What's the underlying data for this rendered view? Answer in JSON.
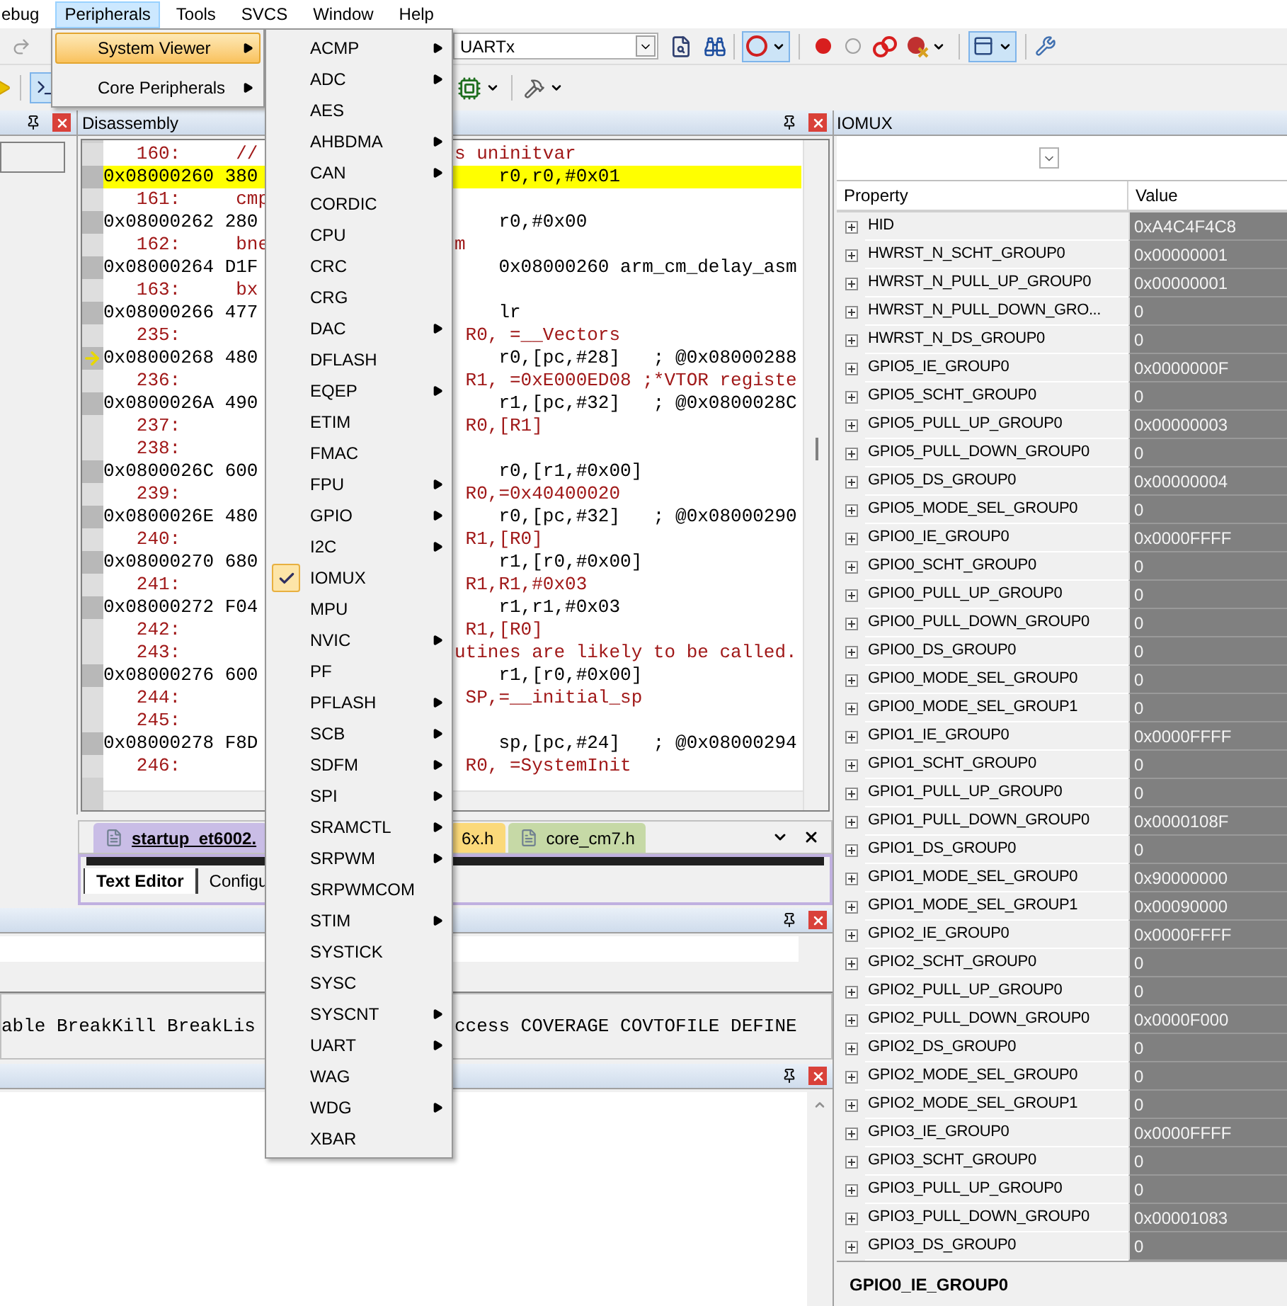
{
  "menubar": [
    {
      "label": "ebug",
      "selected": false
    },
    {
      "label": "Peripherals",
      "selected": true
    },
    {
      "label": "Tools",
      "selected": false
    },
    {
      "label": "SVCS",
      "selected": false
    },
    {
      "label": "Window",
      "selected": false
    },
    {
      "label": "Help",
      "selected": false
    }
  ],
  "peripherals_menu": [
    {
      "label": "System Viewer",
      "selected": true,
      "submenu": true
    },
    {
      "label": "Core Peripherals",
      "selected": false,
      "submenu": true
    }
  ],
  "system_viewer_menu": [
    {
      "label": "ACMP",
      "submenu": true,
      "checked": false
    },
    {
      "label": "ADC",
      "submenu": true,
      "checked": false
    },
    {
      "label": "AES",
      "submenu": false,
      "checked": false
    },
    {
      "label": "AHBDMA",
      "submenu": true,
      "checked": false
    },
    {
      "label": "CAN",
      "submenu": true,
      "checked": false
    },
    {
      "label": "CORDIC",
      "submenu": false,
      "checked": false
    },
    {
      "label": "CPU",
      "submenu": false,
      "checked": false
    },
    {
      "label": "CRC",
      "submenu": false,
      "checked": false
    },
    {
      "label": "CRG",
      "submenu": false,
      "checked": false
    },
    {
      "label": "DAC",
      "submenu": true,
      "checked": false
    },
    {
      "label": "DFLASH",
      "submenu": false,
      "checked": false
    },
    {
      "label": "EQEP",
      "submenu": true,
      "checked": false
    },
    {
      "label": "ETIM",
      "submenu": false,
      "checked": false
    },
    {
      "label": "FMAC",
      "submenu": false,
      "checked": false
    },
    {
      "label": "FPU",
      "submenu": true,
      "checked": false
    },
    {
      "label": "GPIO",
      "submenu": true,
      "checked": false
    },
    {
      "label": "I2C",
      "submenu": true,
      "checked": false
    },
    {
      "label": "IOMUX",
      "submenu": false,
      "checked": true
    },
    {
      "label": "MPU",
      "submenu": false,
      "checked": false
    },
    {
      "label": "NVIC",
      "submenu": true,
      "checked": false
    },
    {
      "label": "PF",
      "submenu": false,
      "checked": false
    },
    {
      "label": "PFLASH",
      "submenu": true,
      "checked": false
    },
    {
      "label": "SCB",
      "submenu": true,
      "checked": false
    },
    {
      "label": "SDFM",
      "submenu": true,
      "checked": false
    },
    {
      "label": "SPI",
      "submenu": true,
      "checked": false
    },
    {
      "label": "SRAMCTL",
      "submenu": true,
      "checked": false
    },
    {
      "label": "SRPWM",
      "submenu": true,
      "checked": false
    },
    {
      "label": "SRPWMCOM",
      "submenu": false,
      "checked": false
    },
    {
      "label": "STIM",
      "submenu": true,
      "checked": false
    },
    {
      "label": "SYSTICK",
      "submenu": false,
      "checked": false
    },
    {
      "label": "SYSC",
      "submenu": false,
      "checked": false
    },
    {
      "label": "SYSCNT",
      "submenu": true,
      "checked": false
    },
    {
      "label": "UART",
      "submenu": true,
      "checked": false
    },
    {
      "label": "WAG",
      "submenu": false,
      "checked": false
    },
    {
      "label": "WDG",
      "submenu": true,
      "checked": false
    },
    {
      "label": "XBAR",
      "submenu": false,
      "checked": false
    }
  ],
  "toolbar": {
    "target_combo": "UARTx"
  },
  "disassembly": {
    "title": "Disassembly",
    "rows": [
      {
        "kind": "src",
        "left": "   160:     //",
        "right": "s uninitvar",
        "highlighted": false,
        "current": false
      },
      {
        "kind": "asm",
        "left": "0x08000260 380",
        "right": "    r0,r0,#0x01",
        "highlighted": true,
        "current": false
      },
      {
        "kind": "src",
        "left": "   161:     cmp",
        "right": "",
        "highlighted": false,
        "current": false
      },
      {
        "kind": "asm",
        "left": "0x08000262 280",
        "right": "    r0,#0x00",
        "highlighted": false,
        "current": false
      },
      {
        "kind": "src",
        "left": "   162:     bne",
        "right": "m",
        "highlighted": false,
        "current": false
      },
      {
        "kind": "asm",
        "left": "0x08000264 D1F",
        "right": "    0x08000260 arm_cm_delay_asm",
        "highlighted": false,
        "current": false
      },
      {
        "kind": "src",
        "left": "   163:     bx",
        "right": "",
        "highlighted": false,
        "current": false
      },
      {
        "kind": "asm",
        "left": "0x08000266 477",
        "right": "    lr",
        "highlighted": false,
        "current": false
      },
      {
        "kind": "src",
        "left": "   235:",
        "right": " R0, =__Vectors",
        "highlighted": false,
        "current": false
      },
      {
        "kind": "asm",
        "left": "0x08000268 480",
        "right": "    r0,[pc,#28]   ; @0x08000288",
        "highlighted": false,
        "current": true
      },
      {
        "kind": "src",
        "left": "   236:",
        "right": " R1, =0xE000ED08 ;*VTOR registe",
        "highlighted": false,
        "current": false
      },
      {
        "kind": "asm",
        "left": "0x0800026A 490",
        "right": "    r1,[pc,#32]   ; @0x0800028C",
        "highlighted": false,
        "current": false
      },
      {
        "kind": "src",
        "left": "   237:",
        "right": " R0,[R1]",
        "highlighted": false,
        "current": false
      },
      {
        "kind": "src",
        "left": "   238:",
        "right": "",
        "highlighted": false,
        "current": false
      },
      {
        "kind": "asm",
        "left": "0x0800026C 600",
        "right": "    r0,[r1,#0x00]",
        "highlighted": false,
        "current": false
      },
      {
        "kind": "src",
        "left": "   239:",
        "right": " R0,=0x40400020",
        "highlighted": false,
        "current": false
      },
      {
        "kind": "asm",
        "left": "0x0800026E 480",
        "right": "    r0,[pc,#32]   ; @0x08000290",
        "highlighted": false,
        "current": false
      },
      {
        "kind": "src",
        "left": "   240:",
        "right": " R1,[R0]",
        "highlighted": false,
        "current": false
      },
      {
        "kind": "asm",
        "left": "0x08000270 680",
        "right": "    r1,[r0,#0x00]",
        "highlighted": false,
        "current": false
      },
      {
        "kind": "src",
        "left": "   241:",
        "right": " R1,R1,#0x03",
        "highlighted": false,
        "current": false
      },
      {
        "kind": "asm",
        "left": "0x08000272 F04",
        "right": "    r1,r1,#0x03",
        "highlighted": false,
        "current": false
      },
      {
        "kind": "src",
        "left": "   242:",
        "right": " R1,[R0]",
        "highlighted": false,
        "current": false
      },
      {
        "kind": "src",
        "left": "   243:",
        "right": "utines are likely to be called.",
        "highlighted": false,
        "current": false
      },
      {
        "kind": "asm",
        "left": "0x08000276 600",
        "right": "    r1,[r0,#0x00]",
        "highlighted": false,
        "current": false
      },
      {
        "kind": "src",
        "left": "   244:",
        "right": " SP,=__initial_sp",
        "highlighted": false,
        "current": false
      },
      {
        "kind": "src",
        "left": "   245:",
        "right": "",
        "highlighted": false,
        "current": false
      },
      {
        "kind": "asm",
        "left": "0x08000278 F8D",
        "right": "    sp,[pc,#24]   ; @0x08000294",
        "highlighted": false,
        "current": false
      },
      {
        "kind": "src",
        "left": "   246:",
        "right": " R0, =SystemInit",
        "highlighted": false,
        "current": false
      }
    ]
  },
  "file_tabs": [
    {
      "label": "startup_et6002.",
      "color": "#c9bde6",
      "selected": true
    },
    {
      "label": "6x.h",
      "color": "#fbd97a",
      "selected": false
    },
    {
      "label": "core_cm7.h",
      "color": "#c6d9a6",
      "selected": false
    }
  ],
  "editor_tabs": [
    {
      "label": "Text Editor",
      "selected": true
    },
    {
      "label": "Configu",
      "selected": false
    }
  ],
  "command": {
    "help_left": "able BreakKill BreakLis",
    "help_right": "ccess COVERAGE COVTOFILE DEFINE"
  },
  "iomux": {
    "title": "IOMUX",
    "columns": [
      "Property",
      "Value"
    ],
    "footer": "GPIO0_IE_GROUP0",
    "rows": [
      {
        "name": "HID",
        "value": "0xA4C4F4C8",
        "expanded": false
      },
      {
        "name": "HWRST_N_SCHT_GROUP0",
        "value": "0x00000001",
        "expanded": false
      },
      {
        "name": "HWRST_N_PULL_UP_GROUP0",
        "value": "0x00000001",
        "expanded": false
      },
      {
        "name": "HWRST_N_PULL_DOWN_GRO...",
        "value": "0",
        "expanded": false
      },
      {
        "name": "HWRST_N_DS_GROUP0",
        "value": "0",
        "expanded": false
      },
      {
        "name": "GPIO5_IE_GROUP0",
        "value": "0x0000000F",
        "expanded": false
      },
      {
        "name": "GPIO5_SCHT_GROUP0",
        "value": "0",
        "expanded": false
      },
      {
        "name": "GPIO5_PULL_UP_GROUP0",
        "value": "0x00000003",
        "expanded": false
      },
      {
        "name": "GPIO5_PULL_DOWN_GROUP0",
        "value": "0",
        "expanded": false
      },
      {
        "name": "GPIO5_DS_GROUP0",
        "value": "0x00000004",
        "expanded": false
      },
      {
        "name": "GPIO5_MODE_SEL_GROUP0",
        "value": "0",
        "expanded": false
      },
      {
        "name": "GPIO0_IE_GROUP0",
        "value": "0x0000FFFF",
        "expanded": false
      },
      {
        "name": "GPIO0_SCHT_GROUP0",
        "value": "0",
        "expanded": false
      },
      {
        "name": "GPIO0_PULL_UP_GROUP0",
        "value": "0",
        "expanded": false
      },
      {
        "name": "GPIO0_PULL_DOWN_GROUP0",
        "value": "0",
        "expanded": false
      },
      {
        "name": "GPIO0_DS_GROUP0",
        "value": "0",
        "expanded": false
      },
      {
        "name": "GPIO0_MODE_SEL_GROUP0",
        "value": "0",
        "expanded": false
      },
      {
        "name": "GPIO0_MODE_SEL_GROUP1",
        "value": "0",
        "expanded": false
      },
      {
        "name": "GPIO1_IE_GROUP0",
        "value": "0x0000FFFF",
        "expanded": false
      },
      {
        "name": "GPIO1_SCHT_GROUP0",
        "value": "0",
        "expanded": false
      },
      {
        "name": "GPIO1_PULL_UP_GROUP0",
        "value": "0",
        "expanded": false
      },
      {
        "name": "GPIO1_PULL_DOWN_GROUP0",
        "value": "0x0000108F",
        "expanded": false
      },
      {
        "name": "GPIO1_DS_GROUP0",
        "value": "0",
        "expanded": false
      },
      {
        "name": "GPIO1_MODE_SEL_GROUP0",
        "value": "0x90000000",
        "expanded": false
      },
      {
        "name": "GPIO1_MODE_SEL_GROUP1",
        "value": "0x00090000",
        "expanded": false
      },
      {
        "name": "GPIO2_IE_GROUP0",
        "value": "0x0000FFFF",
        "expanded": false
      },
      {
        "name": "GPIO2_SCHT_GROUP0",
        "value": "0",
        "expanded": false
      },
      {
        "name": "GPIO2_PULL_UP_GROUP0",
        "value": "0",
        "expanded": false
      },
      {
        "name": "GPIO2_PULL_DOWN_GROUP0",
        "value": "0x0000F000",
        "expanded": false
      },
      {
        "name": "GPIO2_DS_GROUP0",
        "value": "0",
        "expanded": false
      },
      {
        "name": "GPIO2_MODE_SEL_GROUP0",
        "value": "0",
        "expanded": false
      },
      {
        "name": "GPIO2_MODE_SEL_GROUP1",
        "value": "0",
        "expanded": false
      },
      {
        "name": "GPIO3_IE_GROUP0",
        "value": "0x0000FFFF",
        "expanded": false
      },
      {
        "name": "GPIO3_SCHT_GROUP0",
        "value": "0",
        "expanded": false
      },
      {
        "name": "GPIO3_PULL_UP_GROUP0",
        "value": "0",
        "expanded": false
      },
      {
        "name": "GPIO3_PULL_DOWN_GROUP0",
        "value": "0x00001083",
        "expanded": false
      },
      {
        "name": "GPIO3_DS_GROUP0",
        "value": "0",
        "expanded": false
      }
    ]
  }
}
